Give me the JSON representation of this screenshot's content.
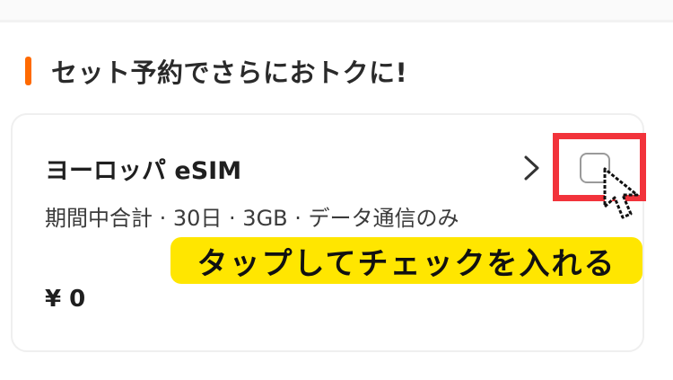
{
  "section": {
    "title": "セット予約でさらにおトクに!",
    "accent_color": "#ff6a00"
  },
  "product": {
    "name": "ヨーロッパ eSIM",
    "description": "期間中合計 · 30日 · 3GB · データ通信のみ",
    "price": "¥ 0",
    "selected": false,
    "chevron_icon": "chevron-right-icon"
  },
  "annotation": {
    "instruction": "タップしてチェックを入れる",
    "highlight_color": "#f2333b",
    "banner_color": "#ffe600",
    "cursor_icon": "pointer-arrow-icon"
  }
}
